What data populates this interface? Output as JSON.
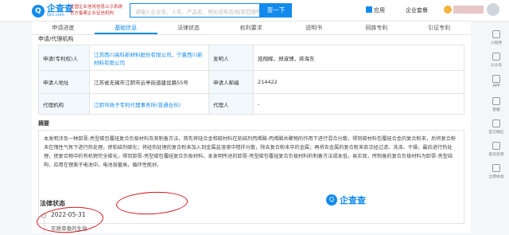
{
  "header": {
    "logo_cn": "企查查",
    "logo_en": "Qcc.com",
    "badge_line1": "全国企业信用信息公示系统",
    "badge_line2": "官方备案企业征信机构",
    "search_placeholder": "请输入企业名、人名、产品名、地址或电话/经营范围等",
    "search_button": "查一下",
    "nav_items": [
      "应用",
      "企业套餐"
    ]
  },
  "tabs": [
    {
      "label": "申请进度",
      "active": false
    },
    {
      "label": "基础信息",
      "active": true
    },
    {
      "label": "法律状态",
      "active": false
    },
    {
      "label": "权利要求",
      "active": false
    },
    {
      "label": "说明书",
      "active": false
    },
    {
      "label": "同族专利",
      "active": false
    },
    {
      "label": "引证专利",
      "active": false
    }
  ],
  "section_cut": "申请/代理机构",
  "info_table": {
    "row1": {
      "label": "申请(专利权)人",
      "value": "江苏西川高科新材料股份有限公司，宁夏西川新材料有限公司",
      "label2": "发明人",
      "value2": "庞翔辉，郑淑博，蒋海东"
    },
    "row2": {
      "label": "申请人地址",
      "value": "江苏省无锡市江阴市云亭街道建设路55号",
      "label2": "申请人邮编",
      "value2": "214422"
    },
    "row3": {
      "label": "代理机构",
      "value": "江阴市扬子专利代理事务所(普通合伙)",
      "label2": "代理人",
      "value2": "-"
    }
  },
  "abstract": {
    "title": "摘要",
    "text": "本发明涉及一种卸膏-亮型碳包覆硅复合负极材料及其制备方法，首先将硅合金和碳材料在粘结剂丙烯酸-丙烯酸共聚物的作用下进行混合分散，得到碳材料包覆硅合金的复合粉末，后将复合粉末在惰性气氛下进行热处理，使粘结剂碳化；将经热处理的复合粉末加入到金属盐溶液中搅拌分散，除去复合粉末中的金属；再将去金属的复合粉末依次经过滤、洗涤、干燥，最后进行热处理，使复合物中的有机物完全碳化，得到卸膏-亮型碳包覆硅复合负极材料。本发明所述的卸膏-亮型碳包覆硅复合负极材料的制备方法成本低，易实现，所制备的复合负极材料为卸膏-亮型结构，应用在锂离子电池中，电池容量高，循环性能好。"
  },
  "legal_status": {
    "title": "法律状态",
    "date": "2022-05-31",
    "status": "实质审查的生效"
  },
  "watermark": "企查查",
  "sidebar": [
    "小程序",
    "公众号",
    "APP",
    "客服",
    "官方微信",
    "意见反馈",
    "立即体验"
  ]
}
